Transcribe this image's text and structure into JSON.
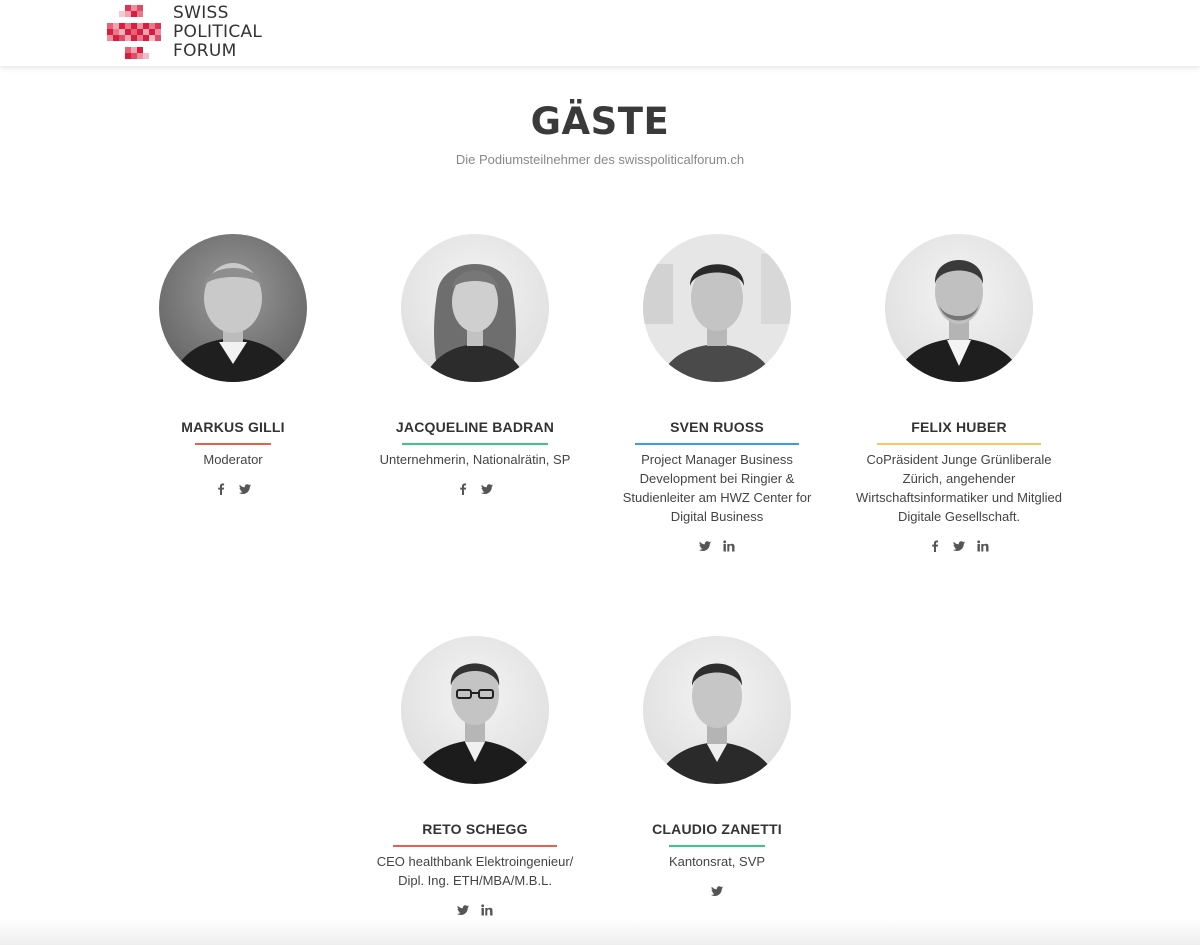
{
  "header": {
    "logo_lines": [
      "SWISS",
      "POLITICAL",
      "FORUM"
    ]
  },
  "section": {
    "title": "GÄSTE",
    "subtitle": "Die Podiumsteilnehmer des swisspoliticalforum.ch"
  },
  "guests": [
    {
      "name": "MARKUS GILLI",
      "role": "Moderator",
      "accent": "#e8604c",
      "socials": [
        "facebook",
        "twitter"
      ]
    },
    {
      "name": "JACQUELINE BADRAN",
      "role": "Unternehmerin, Nationalrätin, SP",
      "accent": "#3cc68a",
      "socials": [
        "facebook",
        "twitter"
      ]
    },
    {
      "name": "SVEN RUOSS",
      "role": "Project Manager Business Development bei Ringier & Studienleiter am HWZ Center for Digital Business",
      "accent": "#3a9ee0",
      "socials": [
        "twitter",
        "linkedin"
      ]
    },
    {
      "name": "FELIX HUBER",
      "role": "CoPräsident Junge Grünliberale Zürich, angehender Wirtschaftsinformatiker und Mitglied Digitale Gesellschaft.",
      "accent": "#f6c85f",
      "socials": [
        "facebook",
        "twitter",
        "linkedin"
      ]
    },
    {
      "name": "RETO SCHEGG",
      "role": "CEO healthbank Elektroingenieur/ Dipl. Ing. ETH/MBA/M.B.L.",
      "accent": "#e8604c",
      "socials": [
        "twitter",
        "linkedin"
      ]
    },
    {
      "name": "CLAUDIO ZANETTI",
      "role": "Kantonsrat, SVP",
      "accent": "#3cc68a",
      "socials": [
        "twitter"
      ]
    }
  ],
  "colors": {
    "logo_red": "#d81e3f",
    "text_dark": "#333333",
    "text_muted": "#888888"
  }
}
